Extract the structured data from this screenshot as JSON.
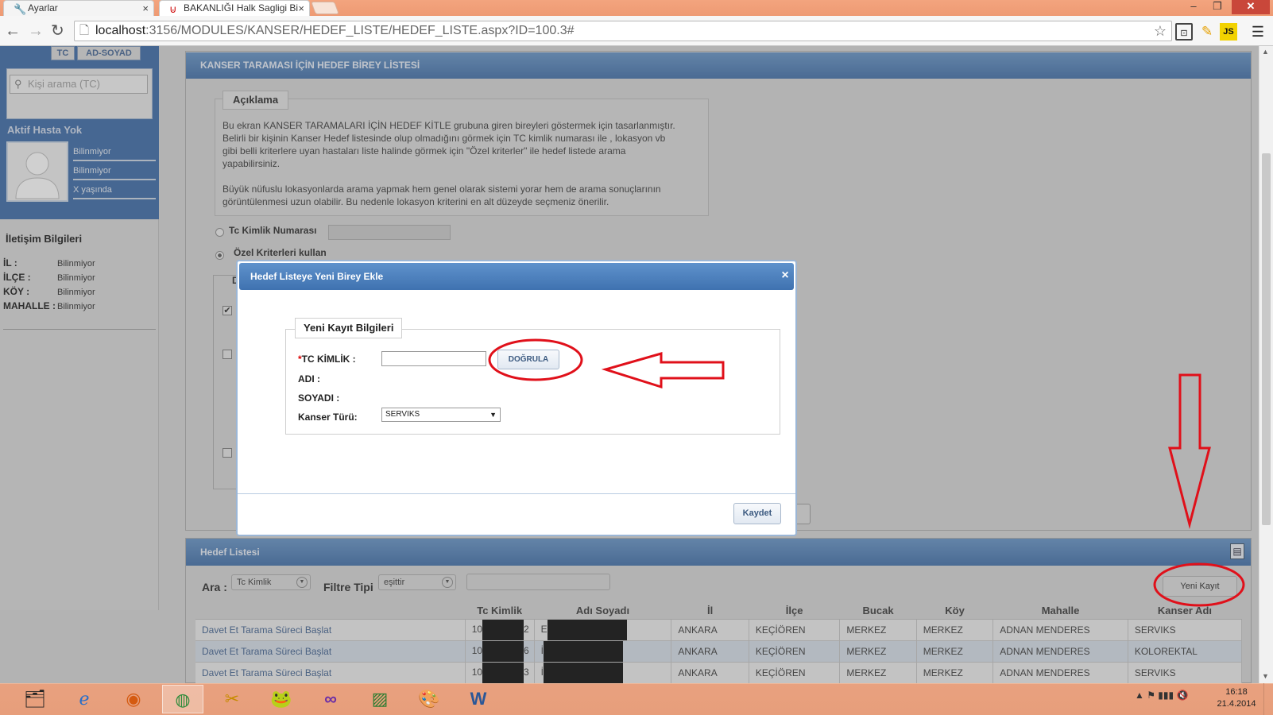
{
  "browser": {
    "tabs": [
      {
        "label": "Ayarlar",
        "icon": "wrench-icon"
      },
      {
        "label": "BAKANLIĞI Halk Sagligi Bi",
        "icon": "ministry-logo-icon"
      }
    ],
    "url_host": "localhost",
    "url_path": ":3156/MODULES/KANSER/HEDEF_LISTE/HEDEF_LISTE.aspx?ID=100.3#"
  },
  "sidebar": {
    "tab_tc": "TC",
    "tab_adsoyad": "AD-SOYAD",
    "search_placeholder": "Kişi arama (TC)",
    "status": "Aktif Hasta Yok",
    "patient_lines": [
      "Bilinmiyor",
      "Bilinmiyor",
      "X yaşında"
    ],
    "contact_title": "İletişim Bilgileri",
    "contact": [
      {
        "label": "İL :",
        "value": "Bilinmiyor"
      },
      {
        "label": "İLÇE :",
        "value": "Bilinmiyor"
      },
      {
        "label": "KÖY :",
        "value": "Bilinmiyor"
      },
      {
        "label": "MAHALLE :",
        "value": "Bilinmiyor"
      }
    ]
  },
  "main": {
    "title": "KANSER TARAMASI İÇİN HEDEF BİREY LİSTESİ",
    "desc_legend": "Açıklama",
    "desc_lines": [
      "Bu ekran KANSER TARAMALARI İÇİN HEDEF KİTLE grubuna giren bireyleri göstermek için tasarlanmıştır.",
      "Belirli bir kişinin Kanser Hedef listesinde olup olmadığını görmek için TC kimlik numarası ile , lokasyon vb",
      "gibi belli kriterlere uyan hastaları liste halinde görmek için \"Özel kriterler\" ile hedef listede arama",
      "yapabilirsiniz.",
      "",
      "Büyük nüfuslu lokasyonlarda arama yapmak hem genel olarak sistemi yorar hem de arama sonuçlarının",
      "görüntülenmesi uzun olabilir. Bu nedenle lokasyon kriterini en alt düzeyde seçmeniz önerilir."
    ],
    "tc_radio_label": "Tc Kimlik Numarası",
    "ozel_radio_label": "Özel Kriterleri kullan",
    "sub_legend_letter": "D"
  },
  "list": {
    "title": "Hedef Listesi",
    "search_label": "Ara :",
    "search_field": "Tc Kimlik",
    "filter_label": "Filtre Tipi",
    "filter_type": "eşittir",
    "new_record_button": "Yeni Kayıt",
    "columns": [
      "",
      "Tc Kimlik",
      "Adı Soyadı",
      "İl",
      "İlçe",
      "Bucak",
      "Köy",
      "Mahalle",
      "Kanser Adı"
    ],
    "rows": [
      {
        "action": "Davet Et Tarama Süreci Başlat",
        "tc": "10",
        "tc_end": "2",
        "name": "E",
        "il": "ANKARA",
        "ilce": "KEÇİÖREN",
        "bucak": "MERKEZ",
        "koy": "MERKEZ",
        "mahalle": "ADNAN MENDERES",
        "kanser": "SERVIKS"
      },
      {
        "action": "Davet Et Tarama Süreci Başlat",
        "tc": "10",
        "tc_end": "6",
        "name": "İ",
        "il": "ANKARA",
        "ilce": "KEÇİÖREN",
        "bucak": "MERKEZ",
        "koy": "MERKEZ",
        "mahalle": "ADNAN MENDERES",
        "kanser": "KOLOREKTAL"
      },
      {
        "action": "Davet Et Tarama Süreci Başlat",
        "tc": "10",
        "tc_end": "3",
        "name": "İ",
        "il": "ANKARA",
        "ilce": "KEÇİÖREN",
        "bucak": "MERKEZ",
        "koy": "MERKEZ",
        "mahalle": "ADNAN MENDERES",
        "kanser": "SERVIKS"
      }
    ]
  },
  "modal": {
    "title": "Hedef Listeye Yeni Birey Ekle",
    "close": "×",
    "legend": "Yeni Kayıt Bilgileri",
    "tc_label": "TC KİMLİK :",
    "required_mark": "*",
    "verify_button": "DOĞRULA",
    "name_label": "ADI :",
    "surname_label": "SOYADI :",
    "cancer_type_label": "Kanser Türü:",
    "cancer_type_value": "SERVIKS",
    "save_button": "Kaydet"
  },
  "annotations": {
    "color": "#e0101a"
  },
  "taskbar": {
    "apps": [
      "file-explorer-icon",
      "internet-explorer-icon",
      "firefox-icon",
      "chrome-icon",
      "paint-tools-icon",
      "frog-app-icon",
      "visual-studio-icon",
      "chart-app-icon",
      "paint-palette-icon",
      "word-icon"
    ],
    "time": "16:18",
    "date": "21.4.2014"
  }
}
